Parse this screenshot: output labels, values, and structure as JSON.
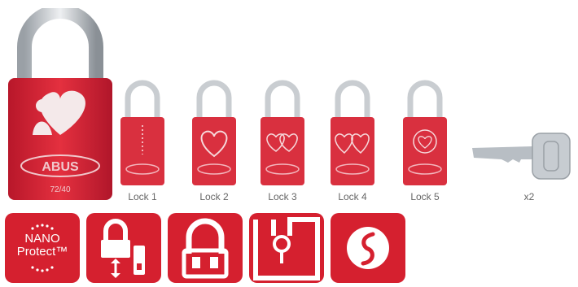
{
  "brand": {
    "text": "ABUS",
    "model": "72/40",
    "color": "#d5202f"
  },
  "locks": [
    {
      "label": "Lock 1",
      "motif": "text-engraving"
    },
    {
      "label": "Lock 2",
      "motif": "heart"
    },
    {
      "label": "Lock 3",
      "motif": "two-hearts"
    },
    {
      "label": "Lock 4",
      "motif": "double-heart"
    },
    {
      "label": "Lock 5",
      "motif": "heart-seal"
    }
  ],
  "key": {
    "label": "x2"
  },
  "features": [
    {
      "name": "nano-protect",
      "line1": "NANO",
      "line2": "Protect™"
    },
    {
      "name": "shackle-release-icon"
    },
    {
      "name": "padlock-shackle-icon"
    },
    {
      "name": "hasp-icon"
    },
    {
      "name": "s-icon"
    }
  ]
}
